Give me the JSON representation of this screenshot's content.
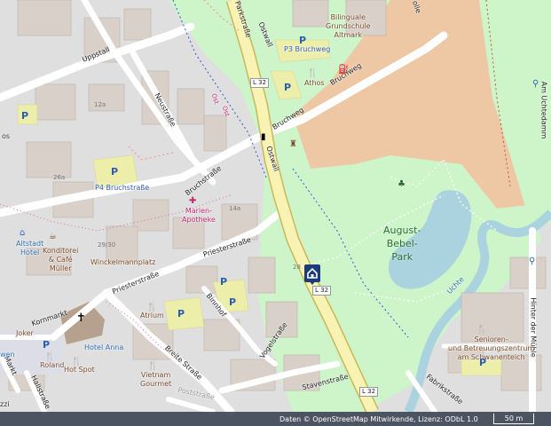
{
  "map": {
    "colors": {
      "background": "#e0dfdf",
      "park": "#cdf5c9",
      "farmland": "#eec8a4",
      "water": "#aad3df",
      "parking": "#eeeeab",
      "main_road": "#f8f3b3",
      "building": "#d9d0c9"
    },
    "streets": {
      "uppstall": "Uppstall",
      "neustrasse": "Neustraße",
      "parkstrasse": "Parkstraße",
      "ostwall": "Ostwall",
      "ostwall_lower": "Ostwall",
      "bruchweg_top": "Bruchweg",
      "bruchweg": "Bruchweg",
      "bruchstrasse": "Bruchstraße",
      "priesterstrasse": "Priesterstraße",
      "priesterstrasse_lower": "Priesterstraße",
      "binnhof": "Binnhof",
      "vogelstrasse": "Vogelstraße",
      "breite_strasse": "Breite Straße",
      "kornmarkt": "Kornmarkt",
      "hallstrasse": "Hallstraße",
      "markt": "Markt",
      "stavenstrasse": "Stavenstraße",
      "fabrikstrasse": "Fabrikstraße",
      "hinter_der_muehle": "Hinter der Mühle",
      "am_uchtedamm": "Am Uchtedamm",
      "postgasse": "Poststraße"
    },
    "road_refs": {
      "l32_top": "L 32",
      "l32_marker": "L 32",
      "l32_bottom": "L 32"
    },
    "places": {
      "park_name": "August-\nBebel-\nPark",
      "school": "Bilinguale\nGrundschule\nAltmark",
      "athos": "Athos",
      "p3_bruchweg": "P3 Bruchweg",
      "p4_bruchstrasse": "P4 Bruchstraße",
      "marien_apotheke": "Marien-\nApotheke",
      "altstadt_hotel": "Altstadt\nHotel",
      "konditorei": "Konditorei\n& Café\nMüller",
      "winckelmannplatz": "Winckelmannplatz",
      "atrium": "Atrium",
      "hotel_anna": "Hotel Anna",
      "joker": "Joker",
      "roland": "Roland",
      "hot_spot": "Hot Spot",
      "vietnam_gourmet": "Vietnam\nGourmet",
      "senioren": "Senioren-\nund Betreuungszentrum\nam Schwanenteich",
      "uchte": "Uchte",
      "ost_label": "Ost",
      "ost_label2": "Ost",
      "fragment_os": "os",
      "fragment_wen": "wen",
      "fragment_zzi": "zzi",
      "fragment_olle": "olle",
      "street_num_26a": "26a",
      "street_num_29_30": "29/30",
      "street_num_12a": "12a",
      "street_num_14a": "14a",
      "street_num_28": "28"
    },
    "attribution": "Daten © OpenStreetMap Mitwirkende, Lizenz: ODbL 1.0",
    "scale_label": "50 m"
  }
}
